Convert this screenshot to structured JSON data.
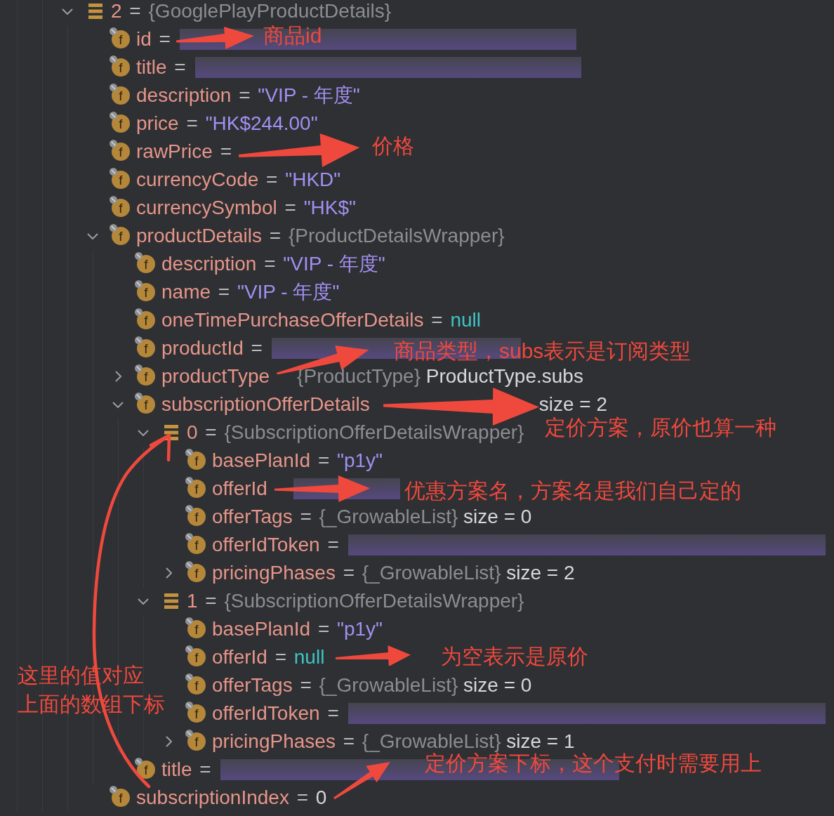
{
  "tree": [
    {
      "kind": "element",
      "expanded": true,
      "parts": [
        {
          "kind": "name",
          "text": "2"
        },
        {
          "kind": "op",
          "text": "="
        },
        {
          "kind": "type",
          "text": "{GooglePlayProductDetails}"
        }
      ],
      "children": [
        {
          "kind": "field",
          "badge": "f",
          "parts": [
            {
              "kind": "name",
              "text": "id"
            },
            {
              "kind": "op",
              "text": "="
            },
            {
              "kind": "redacted"
            }
          ]
        },
        {
          "kind": "field",
          "badge": "f",
          "parts": [
            {
              "kind": "name",
              "text": "title"
            },
            {
              "kind": "op",
              "text": "="
            },
            {
              "kind": "redacted"
            }
          ]
        },
        {
          "kind": "field",
          "badge": "f",
          "parts": [
            {
              "kind": "name",
              "text": "description"
            },
            {
              "kind": "op",
              "text": "="
            },
            {
              "kind": "string",
              "text": "\"VIP - 年度\""
            }
          ]
        },
        {
          "kind": "field",
          "badge": "f",
          "parts": [
            {
              "kind": "name",
              "text": "price"
            },
            {
              "kind": "op",
              "text": "="
            },
            {
              "kind": "string",
              "text": "\"HK$244.00\""
            }
          ]
        },
        {
          "kind": "field",
          "badge": "f",
          "parts": [
            {
              "kind": "name",
              "text": "rawPrice"
            },
            {
              "kind": "op",
              "text": "="
            }
          ]
        },
        {
          "kind": "field",
          "badge": "f",
          "parts": [
            {
              "kind": "name",
              "text": "currencyCode"
            },
            {
              "kind": "op",
              "text": "="
            },
            {
              "kind": "string",
              "text": "\"HKD\""
            }
          ]
        },
        {
          "kind": "field",
          "badge": "f",
          "parts": [
            {
              "kind": "name",
              "text": "currencySymbol"
            },
            {
              "kind": "op",
              "text": "="
            },
            {
              "kind": "string",
              "text": "\"HK$\""
            }
          ]
        },
        {
          "kind": "field",
          "badge": "f",
          "expanded": true,
          "parts": [
            {
              "kind": "name",
              "text": "productDetails"
            },
            {
              "kind": "op",
              "text": "="
            },
            {
              "kind": "type",
              "text": "{ProductDetailsWrapper}"
            }
          ],
          "children": [
            {
              "kind": "field",
              "badge": "f",
              "parts": [
                {
                  "kind": "name",
                  "text": "description"
                },
                {
                  "kind": "op",
                  "text": "="
                },
                {
                  "kind": "string",
                  "text": "\"VIP - 年度\""
                }
              ]
            },
            {
              "kind": "field",
              "badge": "f",
              "parts": [
                {
                  "kind": "name",
                  "text": "name"
                },
                {
                  "kind": "op",
                  "text": "="
                },
                {
                  "kind": "string",
                  "text": "\"VIP - 年度\""
                }
              ]
            },
            {
              "kind": "field",
              "badge": "f",
              "parts": [
                {
                  "kind": "name",
                  "text": "oneTimePurchaseOfferDetails"
                },
                {
                  "kind": "op",
                  "text": "="
                },
                {
                  "kind": "null",
                  "text": "null"
                }
              ]
            },
            {
              "kind": "field",
              "badge": "f",
              "parts": [
                {
                  "kind": "name",
                  "text": "productId"
                },
                {
                  "kind": "op",
                  "text": "="
                },
                {
                  "kind": "redacted"
                }
              ]
            },
            {
              "kind": "field",
              "badge": "f",
              "expanded": false,
              "parts": [
                {
                  "kind": "name",
                  "text": "productType"
                },
                {
                  "kind": "covered"
                },
                {
                  "kind": "type",
                  "text": "{ProductType}"
                },
                {
                  "kind": "plain",
                  "text": "ProductType.subs"
                }
              ]
            },
            {
              "kind": "field",
              "badge": "f",
              "expanded": true,
              "parts": [
                {
                  "kind": "name",
                  "text": "subscriptionOfferDetails"
                },
                {
                  "kind": "covered"
                },
                {
                  "kind": "plain",
                  "text": "size = 2"
                }
              ],
              "children": [
                {
                  "kind": "element",
                  "expanded": true,
                  "parts": [
                    {
                      "kind": "name",
                      "text": "0"
                    },
                    {
                      "kind": "op",
                      "text": "="
                    },
                    {
                      "kind": "type",
                      "text": "{SubscriptionOfferDetailsWrapper}"
                    }
                  ],
                  "children": [
                    {
                      "kind": "field",
                      "badge": "f",
                      "parts": [
                        {
                          "kind": "name",
                          "text": "basePlanId"
                        },
                        {
                          "kind": "op",
                          "text": "="
                        },
                        {
                          "kind": "string",
                          "text": "\"p1y\""
                        }
                      ]
                    },
                    {
                      "kind": "field",
                      "badge": "f",
                      "parts": [
                        {
                          "kind": "name",
                          "text": "offerId"
                        },
                        {
                          "kind": "covered"
                        },
                        {
                          "kind": "redacted"
                        }
                      ]
                    },
                    {
                      "kind": "field",
                      "badge": "f",
                      "parts": [
                        {
                          "kind": "name",
                          "text": "offerTags"
                        },
                        {
                          "kind": "op",
                          "text": "="
                        },
                        {
                          "kind": "type",
                          "text": "{_GrowableList}"
                        },
                        {
                          "kind": "plain",
                          "text": "size = 0"
                        }
                      ]
                    },
                    {
                      "kind": "field",
                      "badge": "f",
                      "parts": [
                        {
                          "kind": "name",
                          "text": "offerIdToken"
                        },
                        {
                          "kind": "op",
                          "text": "="
                        },
                        {
                          "kind": "redacted"
                        }
                      ]
                    },
                    {
                      "kind": "field",
                      "badge": "f",
                      "expanded": false,
                      "parts": [
                        {
                          "kind": "name",
                          "text": "pricingPhases"
                        },
                        {
                          "kind": "op",
                          "text": "="
                        },
                        {
                          "kind": "type",
                          "text": "{_GrowableList}"
                        },
                        {
                          "kind": "plain",
                          "text": "size = 2"
                        }
                      ]
                    }
                  ]
                },
                {
                  "kind": "element",
                  "expanded": true,
                  "parts": [
                    {
                      "kind": "name",
                      "text": "1"
                    },
                    {
                      "kind": "op",
                      "text": "="
                    },
                    {
                      "kind": "type",
                      "text": "{SubscriptionOfferDetailsWrapper}"
                    }
                  ],
                  "children": [
                    {
                      "kind": "field",
                      "badge": "f",
                      "parts": [
                        {
                          "kind": "name",
                          "text": "basePlanId"
                        },
                        {
                          "kind": "op",
                          "text": "="
                        },
                        {
                          "kind": "string",
                          "text": "\"p1y\""
                        }
                      ]
                    },
                    {
                      "kind": "field",
                      "badge": "f",
                      "parts": [
                        {
                          "kind": "name",
                          "text": "offerId"
                        },
                        {
                          "kind": "op",
                          "text": "="
                        },
                        {
                          "kind": "null",
                          "text": "null"
                        }
                      ]
                    },
                    {
                      "kind": "field",
                      "badge": "f",
                      "parts": [
                        {
                          "kind": "name",
                          "text": "offerTags"
                        },
                        {
                          "kind": "op",
                          "text": "="
                        },
                        {
                          "kind": "type",
                          "text": "{_GrowableList}"
                        },
                        {
                          "kind": "plain",
                          "text": "size = 0"
                        }
                      ]
                    },
                    {
                      "kind": "field",
                      "badge": "f",
                      "parts": [
                        {
                          "kind": "name",
                          "text": "offerIdToken"
                        },
                        {
                          "kind": "op",
                          "text": "="
                        },
                        {
                          "kind": "redacted"
                        }
                      ]
                    },
                    {
                      "kind": "field",
                      "badge": "f",
                      "expanded": false,
                      "parts": [
                        {
                          "kind": "name",
                          "text": "pricingPhases"
                        },
                        {
                          "kind": "op",
                          "text": "="
                        },
                        {
                          "kind": "type",
                          "text": "{_GrowableList}"
                        },
                        {
                          "kind": "plain",
                          "text": "size = 1"
                        }
                      ]
                    }
                  ]
                }
              ]
            },
            {
              "kind": "field",
              "badge": "f",
              "parts": [
                {
                  "kind": "name",
                  "text": "title"
                },
                {
                  "kind": "op",
                  "text": "="
                },
                {
                  "kind": "redacted"
                }
              ]
            }
          ]
        },
        {
          "kind": "field",
          "badge": "f",
          "parts": [
            {
              "kind": "name",
              "text": "subscriptionIndex"
            },
            {
              "kind": "op",
              "text": "="
            },
            {
              "kind": "plain",
              "text": "0"
            }
          ]
        }
      ]
    }
  ],
  "annotations": [
    {
      "text": "商品id"
    },
    {
      "text": "价格"
    },
    {
      "text": "商品类型，subs表示是订阅类型"
    },
    {
      "text": "定价方案，原价也算一种"
    },
    {
      "text": "优惠方案名，方案名是我们自己定的"
    },
    {
      "text": "为空表示是原价"
    },
    {
      "text": "这里的值对应"
    },
    {
      "text": "上面的数组下标"
    },
    {
      "text": "定价方案下标，这个支付时需要用上"
    }
  ]
}
